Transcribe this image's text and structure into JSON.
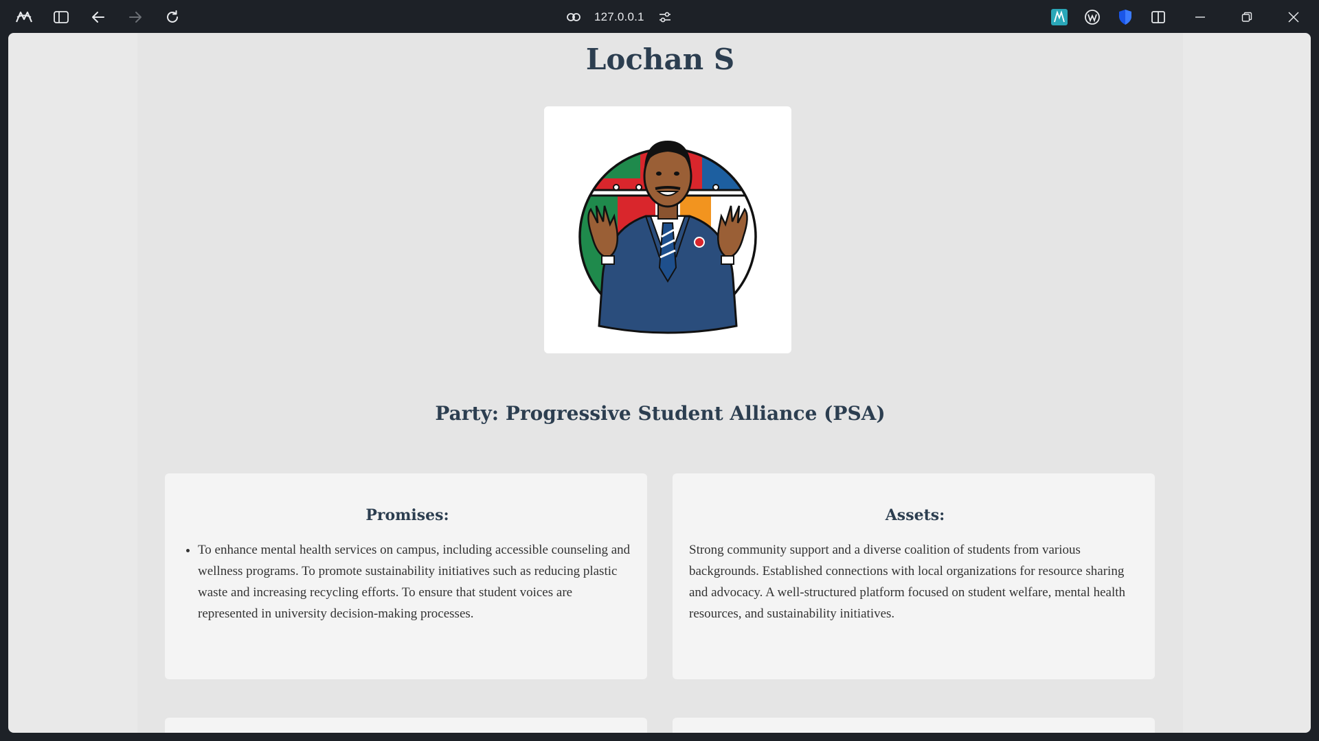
{
  "browser": {
    "url": "127.0.0.1"
  },
  "candidate": {
    "name": "Lochan S",
    "party": "Party: Progressive Student Alliance (PSA)"
  },
  "promises": {
    "heading": "Promises:",
    "items": [
      "To enhance mental health services on campus, including accessible counseling and wellness programs. To promote sustainability initiatives such as reducing plastic waste and increasing recycling efforts. To ensure that student voices are represented in university decision-making processes."
    ]
  },
  "assets": {
    "heading": "Assets:",
    "text": "Strong community support and a diverse coalition of students from various backgrounds. Established connections with local organizations for resource sharing and advocacy. A well-structured platform focused on student welfare, mental health resources, and sustainability initiatives."
  },
  "icons": {
    "browser_logo": "arc-logo-icon",
    "sidebar": "sidebar-toggle-icon",
    "back": "back-arrow-icon",
    "forward": "forward-arrow-icon",
    "reload": "reload-icon",
    "link": "link-icon",
    "site_settings": "sliders-icon",
    "minimize": "minimize-icon",
    "restore": "restore-icon",
    "close": "close-icon"
  },
  "colors": {
    "heading": "#2c3e50",
    "chrome_bg": "#1d2127",
    "page_bg": "#e5e5e5",
    "card_bg": "#f4f4f4"
  }
}
